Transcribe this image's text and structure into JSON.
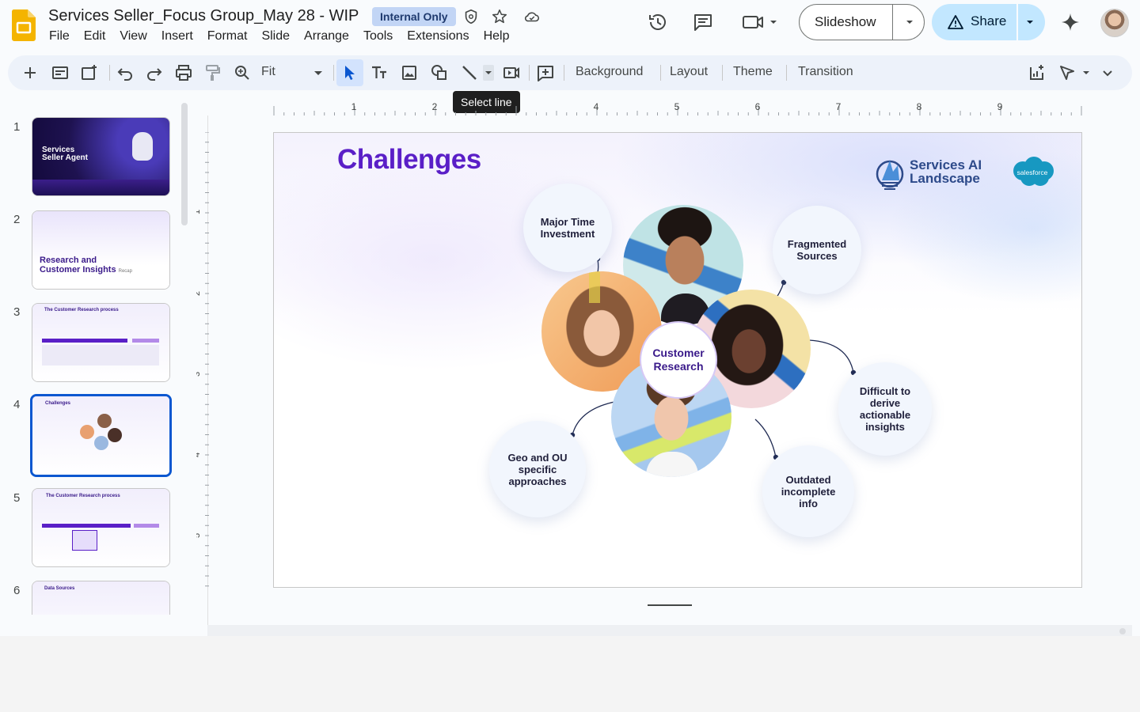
{
  "doc": {
    "title": "Services Seller_Focus Group_May 28 - WIP",
    "badge": "Internal Only"
  },
  "menu": [
    "File",
    "Edit",
    "View",
    "Insert",
    "Format",
    "Slide",
    "Arrange",
    "Tools",
    "Extensions",
    "Help"
  ],
  "header": {
    "slideshow_label": "Slideshow",
    "share_label": "Share"
  },
  "toolbar": {
    "zoom": "Fit",
    "background": "Background",
    "layout": "Layout",
    "theme": "Theme",
    "transition": "Transition",
    "tooltip": "Select line"
  },
  "ruler": {
    "h_ticks": [
      "1",
      "2",
      "4",
      "5",
      "6",
      "7",
      "8",
      "9"
    ],
    "v_ticks": [
      "1",
      "2",
      "3",
      "4",
      "5"
    ]
  },
  "filmstrip": [
    {
      "num": "1",
      "title_line1": "Services",
      "title_line2": "Seller Agent"
    },
    {
      "num": "2",
      "title_line1": "Research and",
      "title_line2": "Customer Insights",
      "tag": "Recap"
    },
    {
      "num": "3",
      "title_line1": "The Customer Research process"
    },
    {
      "num": "4",
      "title_line1": "Challenges"
    },
    {
      "num": "5",
      "title_line1": "The Customer Research process"
    },
    {
      "num": "6",
      "title_line1": "Data Sources"
    }
  ],
  "slide": {
    "title": "Challenges",
    "brand_line1": "Services AI",
    "brand_line2": "Landscape",
    "salesforce": "salesforce",
    "center_line1": "Customer",
    "center_line2": "Research",
    "bubbles": {
      "major_time": [
        "Major Time",
        "Investment"
      ],
      "fragmented": [
        "Fragmented",
        "Sources"
      ],
      "difficult": [
        "Difficult to",
        "derive",
        "actionable",
        "insights"
      ],
      "outdated": [
        "Outdated",
        "incomplete",
        "info"
      ],
      "geo": [
        "Geo and OU",
        "specific",
        "approaches"
      ]
    }
  },
  "colors": {
    "accent": "#0b57d0",
    "title_purple": "#5a1fc7",
    "share_bg": "#c2e7ff",
    "badge_bg": "#c2d5f5"
  }
}
